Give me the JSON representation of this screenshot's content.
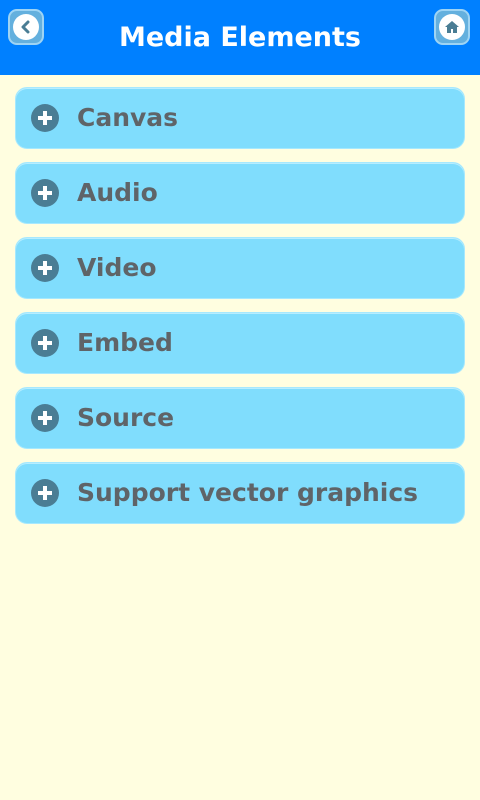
{
  "header": {
    "title": "Media Elements",
    "back_icon": "chevron-left-icon",
    "home_icon": "home-icon",
    "bg_color": "#0080FF"
  },
  "list": {
    "item_icon": "plus-circle-icon",
    "items": [
      {
        "label": "Canvas"
      },
      {
        "label": "Audio"
      },
      {
        "label": "Video"
      },
      {
        "label": "Embed"
      },
      {
        "label": "Source"
      },
      {
        "label": "Support vector graphics"
      }
    ]
  },
  "colors": {
    "page_bg": "#FFFEE0",
    "item_bg": "#80DDFD",
    "item_text": "#5F6468",
    "icon_bg": "#4A7D94"
  }
}
